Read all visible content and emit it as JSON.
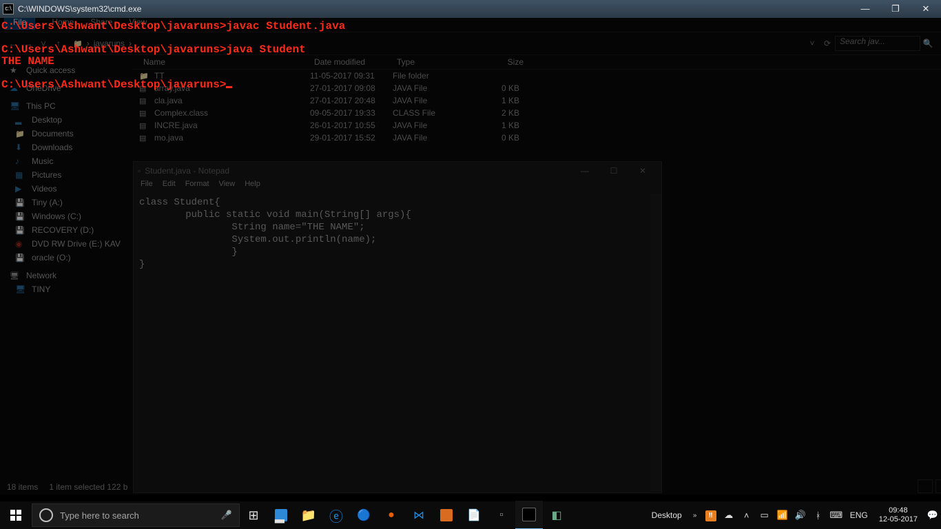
{
  "cmd": {
    "title": "C:\\WINDOWS\\system32\\cmd.exe",
    "lines": [
      "C:\\Users\\Ashwant\\Desktop\\javaruns>javac Student.java",
      "",
      "C:\\Users\\Ashwant\\Desktop\\javaruns>java Student",
      "THE NAME",
      "",
      "C:\\Users\\Ashwant\\Desktop\\javaruns>"
    ]
  },
  "explorer": {
    "tabs": {
      "file": "File",
      "home": "Home",
      "share": "Share",
      "view": "View"
    },
    "breadcrumb": "javaruns",
    "search_placeholder": "Search jav...",
    "columns": {
      "name": "Name",
      "date": "Date modified",
      "type": "Type",
      "size": "Size"
    },
    "sidebar": {
      "quick": "Quick access",
      "onedrive": "OneDrive",
      "thispc": "This PC",
      "items": [
        {
          "label": "Desktop"
        },
        {
          "label": "Documents"
        },
        {
          "label": "Downloads"
        },
        {
          "label": "Music"
        },
        {
          "label": "Pictures"
        },
        {
          "label": "Videos"
        },
        {
          "label": "Tiny (A:)"
        },
        {
          "label": "Windows (C:)"
        },
        {
          "label": "RECOVERY (D:)"
        },
        {
          "label": "DVD RW Drive (E:) KAV"
        },
        {
          "label": "oracle (O:)"
        }
      ],
      "network": "Network",
      "tiny": "TINY"
    },
    "files": [
      {
        "name": "TT",
        "date": "11-05-2017 09:31",
        "type": "File folder",
        "size": ""
      },
      {
        "name": "array.java",
        "date": "27-01-2017 09:08",
        "type": "JAVA File",
        "size": "0 KB"
      },
      {
        "name": "cla.java",
        "date": "27-01-2017 20:48",
        "type": "JAVA File",
        "size": "1 KB"
      },
      {
        "name": "Complex.class",
        "date": "09-05-2017 19:33",
        "type": "CLASS File",
        "size": "2 KB"
      },
      {
        "name": "INCRE.java",
        "date": "26-01-2017 10:55",
        "type": "JAVA File",
        "size": "1 KB"
      },
      {
        "name": "mo.java",
        "date": "29-01-2017 15:52",
        "type": "JAVA File",
        "size": "0 KB"
      }
    ],
    "status_items": "18 items",
    "status_sel": "1 item selected  122 b"
  },
  "notepad": {
    "title": "Student.java - Notepad",
    "menu": {
      "file": "File",
      "edit": "Edit",
      "format": "Format",
      "view": "View",
      "help": "Help"
    },
    "code": "class Student{\n        public static void main(String[] args){\n                String name=\"THE NAME\";\n                System.out.println(name);\n                }\n}"
  },
  "taskbar": {
    "search": "Type here to search",
    "desktop_label": "Desktop",
    "lang": "ENG",
    "time": "09:48",
    "date": "12-05-2017"
  }
}
